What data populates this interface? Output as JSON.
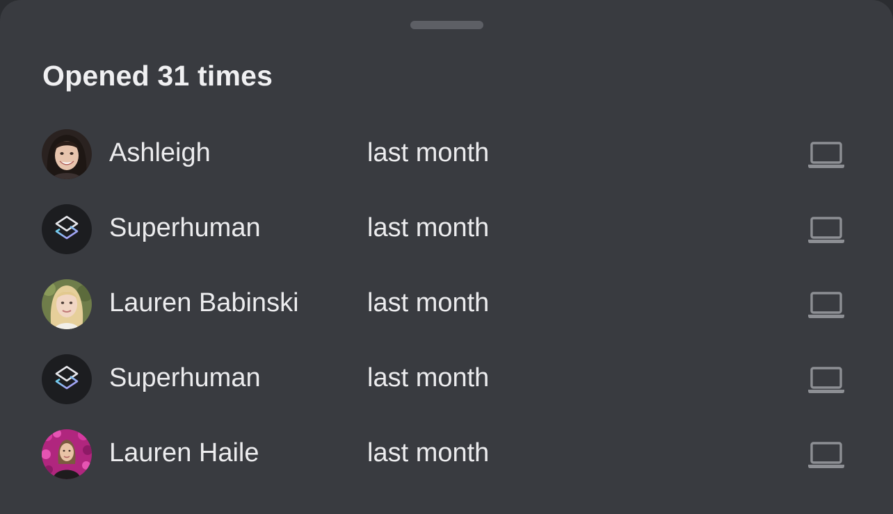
{
  "sheet": {
    "title": "Opened 31 times"
  },
  "opens": [
    {
      "name": "Ashleigh",
      "time": "last month",
      "avatar": "photo-ashleigh",
      "device_icon": "laptop-icon"
    },
    {
      "name": "Superhuman",
      "time": "last month",
      "avatar": "superhuman-logo",
      "device_icon": "laptop-icon"
    },
    {
      "name": "Lauren Babinski",
      "time": "last month",
      "avatar": "photo-lauren-babinski",
      "device_icon": "laptop-icon"
    },
    {
      "name": "Superhuman",
      "time": "last month",
      "avatar": "superhuman-logo",
      "device_icon": "laptop-icon"
    },
    {
      "name": "Lauren Haile",
      "time": "last month",
      "avatar": "photo-lauren-haile",
      "device_icon": "laptop-icon"
    }
  ],
  "colors": {
    "sheet_background": "#393b40",
    "text": "#ececee",
    "grabber": "#5d5f65",
    "device_icon": "#8d8f94"
  }
}
